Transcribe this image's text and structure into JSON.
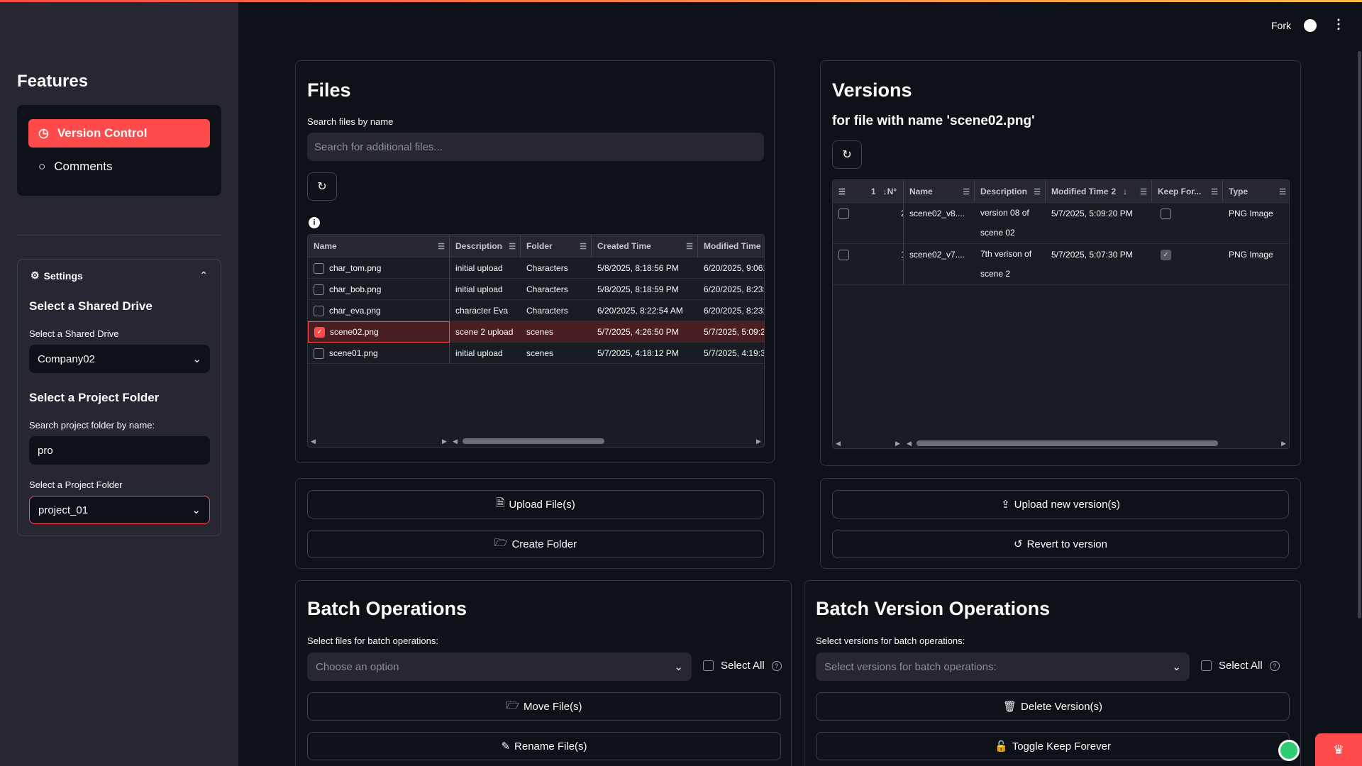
{
  "sidebar": {
    "title": "Features",
    "nav": [
      {
        "label": "Version Control",
        "icon": "clock-icon"
      },
      {
        "label": "Comments",
        "icon": "chat-icon"
      }
    ],
    "settings": {
      "header": "Settings",
      "drive_heading": "Select a Shared Drive",
      "drive_label": "Select a Shared Drive",
      "drive_value": "Company02",
      "folder_heading": "Select a Project Folder",
      "search_label": "Search project folder by name:",
      "search_value": "pro",
      "folder_label": "Select a Project Folder",
      "folder_value": "project_01"
    }
  },
  "header": {
    "fork": "Fork"
  },
  "files": {
    "title": "Files",
    "search_label": "Search files by name",
    "search_placeholder": "Search for additional files...",
    "columns": [
      "Name",
      "Description",
      "Folder",
      "Created Time",
      "Modified Time"
    ],
    "rows": [
      {
        "name": "char_tom.png",
        "description": "initial upload",
        "folder": "Characters",
        "created": "5/8/2025, 8:18:56 PM",
        "modified": "6/20/2025, 9:06:",
        "selected": false
      },
      {
        "name": "char_bob.png",
        "description": "initial upload",
        "folder": "Characters",
        "created": "5/8/2025, 8:18:59 PM",
        "modified": "6/20/2025, 8:23:",
        "selected": false
      },
      {
        "name": "char_eva.png",
        "description": "character Eva",
        "folder": "Characters",
        "created": "6/20/2025, 8:22:54 AM",
        "modified": "6/20/2025, 8:23:",
        "selected": false
      },
      {
        "name": "scene02.png",
        "description": "scene 2 upload",
        "folder": "scenes",
        "created": "5/7/2025, 4:26:50 PM",
        "modified": "5/7/2025, 5:09:2",
        "selected": true
      },
      {
        "name": "scene01.png",
        "description": "initial upload",
        "folder": "scenes",
        "created": "5/7/2025, 4:18:12 PM",
        "modified": "5/7/2025, 4:19:3",
        "selected": false
      }
    ]
  },
  "versions": {
    "title": "Versions",
    "subtitle": "for file with name 'scene02.png'",
    "columns": {
      "sort_a": "1",
      "num": "N°",
      "name": "Name",
      "description": "Description",
      "modified": "Modified Time",
      "sort_b": "2",
      "keep": "Keep For...",
      "type": "Type"
    },
    "rows": [
      {
        "num": "2",
        "name": "scene02_v8....",
        "description_1": "version 08 of",
        "description_2": "scene 02",
        "modified": "5/7/2025, 5:09:20 PM",
        "keep": false,
        "type": "PNG Image"
      },
      {
        "num": "1",
        "name": "scene02_v7....",
        "description_1": "7th verison of",
        "description_2": "scene 2",
        "modified": "5/7/2025, 5:07:30 PM",
        "keep": true,
        "type": "PNG Image"
      }
    ]
  },
  "file_actions": {
    "upload": "Upload File(s)",
    "create_folder": "Create Folder"
  },
  "version_actions": {
    "upload": "Upload new version(s)",
    "revert": "Revert to version"
  },
  "batch": {
    "title": "Batch Operations",
    "label": "Select files for batch operations:",
    "placeholder": "Choose an option",
    "select_all": "Select All",
    "move": "Move File(s)",
    "rename": "Rename File(s)"
  },
  "batch_versions": {
    "title": "Batch Version Operations",
    "label": "Select versions for batch operations:",
    "placeholder": "Select versions for batch operations:",
    "select_all": "Select All",
    "delete": "Delete Version(s)",
    "toggle": "Toggle Keep Forever"
  },
  "colors": {
    "accent": "#ff4b4b",
    "background": "#0e1117",
    "sidebar": "#262730"
  }
}
